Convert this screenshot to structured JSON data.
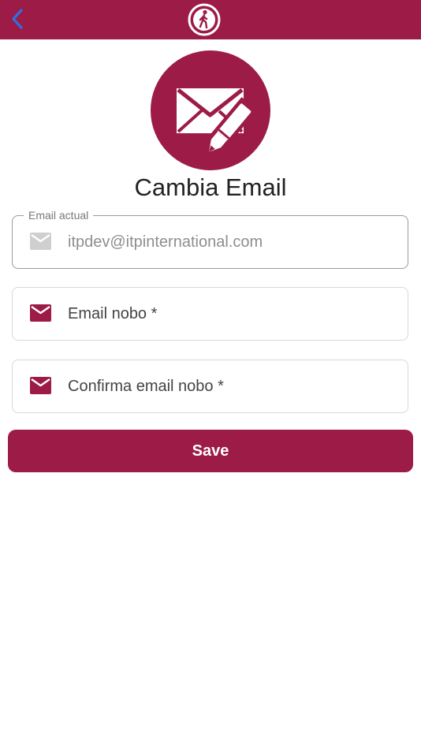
{
  "header": {
    "back_icon": "chevron-left-icon",
    "logo_icon": "walking-person-logo-icon",
    "bar_color": "#9c1b47",
    "back_color": "#2f6fe0"
  },
  "hero": {
    "icon": "envelope-with-pencil-icon",
    "title": "Cambia Email"
  },
  "form": {
    "current": {
      "label": "Email actual",
      "value": "itpdev@itpinternational.com",
      "icon": "mail-icon"
    },
    "new": {
      "placeholder": "Email nobo *",
      "icon": "mail-icon"
    },
    "confirm": {
      "placeholder": "Confirma email nobo *",
      "icon": "mail-icon"
    }
  },
  "actions": {
    "save_label": "Save"
  }
}
